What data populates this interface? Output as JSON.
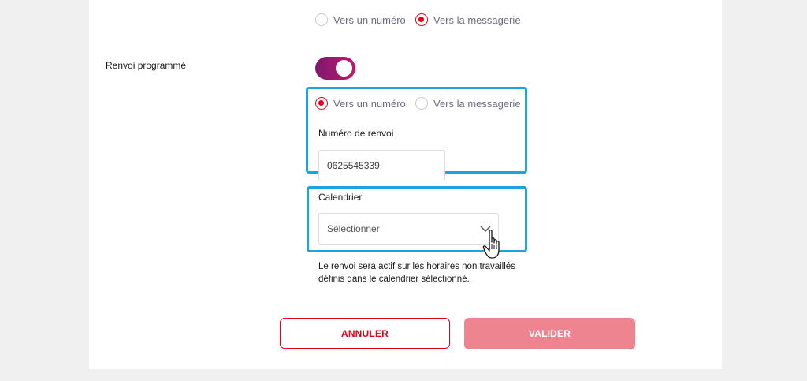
{
  "top_options": {
    "option_number": "Vers un numéro",
    "option_voicemail": "Vers la messagerie",
    "selected": "voicemail"
  },
  "scheduled": {
    "label": "Renvoi programmé",
    "toggle_on": true,
    "option_number": "Vers un numéro",
    "option_voicemail": "Vers la messagerie",
    "selected": "number",
    "number_label": "Numéro de renvoi",
    "number_value": "0625545339",
    "calendar_label": "Calendrier",
    "calendar_value": "Sélectionner",
    "help_line1": "Le renvoi sera actif sur les horaires non travaillés",
    "help_line2": "définis dans le calendrier sélectionné."
  },
  "actions": {
    "cancel": "ANNULER",
    "validate": "VALIDER"
  },
  "colors": {
    "accent": "#e2001a",
    "highlight": "#1fa2e0",
    "validate_bg": "#ee8490",
    "toggle_from": "#7a1a6e",
    "toggle_to": "#c4166b"
  },
  "icons": {
    "dropdown": "chevron-down-icon",
    "cursor": "hand-pointer-icon"
  }
}
